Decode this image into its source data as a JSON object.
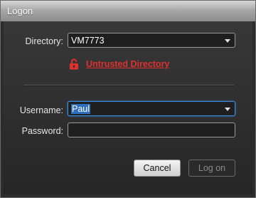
{
  "window": {
    "title": "Logon"
  },
  "form": {
    "directory_label": "Directory:",
    "directory_value": "VM7773",
    "warning_text": "Untrusted Directory",
    "username_label": "Username:",
    "username_value": "Paul",
    "password_label": "Password:",
    "password_value": ""
  },
  "buttons": {
    "cancel": "Cancel",
    "logon": "Log on"
  },
  "colors": {
    "warning": "#e03030",
    "focus": "#3d8be0",
    "selection": "#2f6fbf"
  }
}
